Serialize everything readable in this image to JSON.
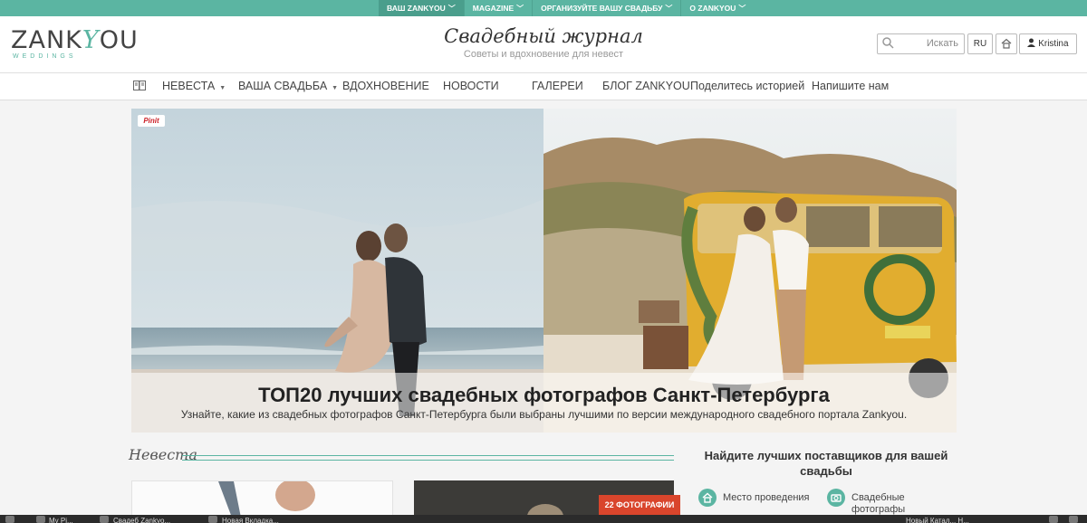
{
  "topbar": {
    "tabs": [
      {
        "label": "ВАШ ZANKYOU",
        "chevron": "chevron-down-icon"
      },
      {
        "label": "MAGAZINE",
        "chevron": "chevron-down-icon"
      },
      {
        "label": "ОРГАНИЗУЙТЕ ВАШУ СВАДЬБУ",
        "chevron": "chevron-down-icon"
      },
      {
        "label": "О ZANKYOU",
        "chevron": "chevron-down-icon"
      }
    ]
  },
  "header": {
    "logo": {
      "before": "ZANK",
      "y": "Y",
      "after": "OU",
      "sub": "WEDDINGS"
    },
    "magazine_title": "Свадебный журнал",
    "magazine_subtitle": "Советы и вдохновение для невест",
    "search": {
      "placeholder": "Искать",
      "icon": "search-icon"
    },
    "language": "RU",
    "home_icon": "house-icon",
    "user": {
      "icon": "user-icon",
      "name": "Kristina"
    }
  },
  "nav": {
    "items": [
      {
        "label": "НЕВЕСТА",
        "has_caret": true
      },
      {
        "label": "ВАША СВАДЬБА",
        "has_caret": true
      },
      {
        "label": "ВДОХНОВЕНИЕ",
        "has_caret": false
      },
      {
        "label": "НОВОСТИ",
        "has_caret": false
      },
      {
        "label": "ГАЛЕРЕИ",
        "has_caret": false
      },
      {
        "label": "БЛОГ ZANKYOU",
        "has_caret": false
      },
      {
        "label": "Поделитесь историей",
        "has_caret": false
      },
      {
        "label": "Напишите нам",
        "has_caret": false
      }
    ],
    "book_icon": "book-icon"
  },
  "hero": {
    "pinit": "Pinit",
    "title": "ТОП20 лучших свадебных фотографов Санкт-Петербурга",
    "description": "Узнайте, какие из свадебных фотографов Санкт-Петербурга были выбраны лучшими по версии международного свадебного портала Zankyou."
  },
  "section": {
    "title": "Невеста",
    "badge": "22 ФОТОГРАФИИ"
  },
  "sidebar": {
    "title": "Найдите лучших поставщиков для вашей свадьбы",
    "vendors": [
      {
        "label": "Место проведения",
        "icon": "venue-icon"
      },
      {
        "label": "Свадебные фотографы",
        "icon": "camera-icon"
      }
    ]
  },
  "taskbar": {
    "items": [
      "My Pi...",
      "Свадеб Zankyo...",
      "Новая Вкладка...",
      "Новый Катал... Н..."
    ]
  },
  "colors": {
    "accent": "#5bb5a2",
    "badge": "#d9452c",
    "taskbar": "#2b2b2b"
  }
}
